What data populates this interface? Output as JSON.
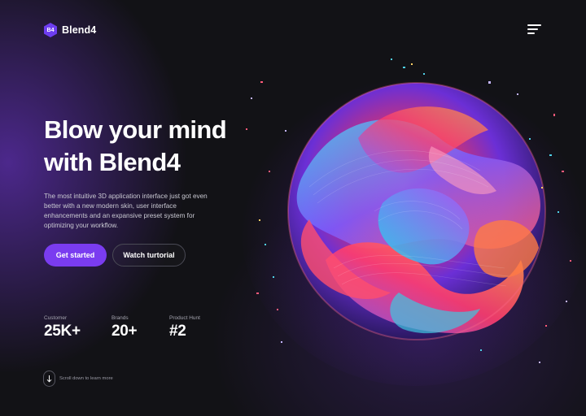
{
  "header": {
    "logo_badge": "B4",
    "logo_text": "Blend4",
    "menu_icon": "hamburger-menu-icon"
  },
  "hero": {
    "headline_line1": "Blow your mind",
    "headline_line2": "with Blend4",
    "description": "The most intuitive 3D application interface just got even better with a new modern skin, user interface enhancements and an expansive preset system for optimizing your workflow.",
    "primary_button": "Get started",
    "secondary_button": "Watch turtorial"
  },
  "stats": [
    {
      "label": "Customer",
      "value": "25K+"
    },
    {
      "label": "Brands",
      "value": "20+"
    },
    {
      "label": "Product Hunt",
      "value": "#2"
    }
  ],
  "scroll_hint": {
    "text": "Scroll down to learn more",
    "icon": "arrow-down-icon"
  },
  "colors": {
    "accent": "#7a3cf0",
    "background": "#121216",
    "text": "#ffffff",
    "muted_text": "#c9c9d2"
  },
  "artwork": {
    "icon": "abstract-3d-sphere-illustration"
  }
}
